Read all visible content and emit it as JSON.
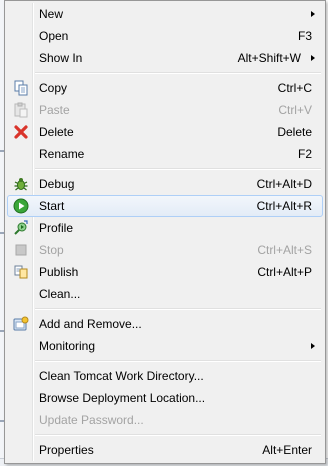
{
  "menu": {
    "new": {
      "label": "New"
    },
    "open": {
      "label": "Open",
      "shortcut": "F3"
    },
    "show_in": {
      "label": "Show In",
      "shortcut": "Alt+Shift+W"
    },
    "copy": {
      "label": "Copy",
      "shortcut": "Ctrl+C",
      "icon": "copy-icon"
    },
    "paste": {
      "label": "Paste",
      "shortcut": "Ctrl+V",
      "icon": "paste-icon"
    },
    "delete": {
      "label": "Delete",
      "shortcut": "Delete",
      "icon": "delete-icon"
    },
    "rename": {
      "label": "Rename",
      "shortcut": "F2"
    },
    "debug": {
      "label": "Debug",
      "shortcut": "Ctrl+Alt+D",
      "icon": "debug-bug-icon"
    },
    "start": {
      "label": "Start",
      "shortcut": "Ctrl+Alt+R",
      "icon": "run-play-icon"
    },
    "profile": {
      "label": "Profile",
      "icon": "profile-icon"
    },
    "stop": {
      "label": "Stop",
      "shortcut": "Ctrl+Alt+S",
      "icon": "stop-icon"
    },
    "publish": {
      "label": "Publish",
      "shortcut": "Ctrl+Alt+P",
      "icon": "publish-icon"
    },
    "clean": {
      "label": "Clean..."
    },
    "add_remove": {
      "label": "Add and Remove...",
      "icon": "add-remove-icon"
    },
    "monitoring": {
      "label": "Monitoring"
    },
    "clean_tomcat": {
      "label": "Clean Tomcat Work Directory..."
    },
    "browse_deploy": {
      "label": "Browse Deployment Location..."
    },
    "update_password": {
      "label": "Update Password..."
    },
    "properties": {
      "label": "Properties",
      "shortcut": "Alt+Enter"
    }
  },
  "colors": {
    "menu_bg": "#f0f0f0",
    "selection_border": "#aecff7",
    "disabled_text": "#a3a3a3",
    "delete_red": "#d9342b",
    "run_green": "#3aa63a"
  }
}
